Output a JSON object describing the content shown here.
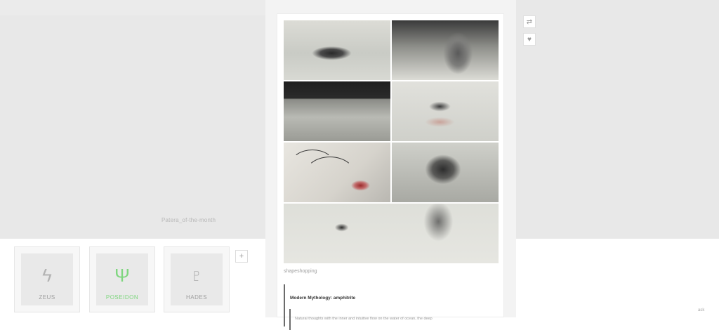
{
  "left_panel": {
    "caption": "Patera_of-the-month"
  },
  "post": {
    "source": "shapeshopping",
    "quote": {
      "title": "Modern Mythology: amphitrite",
      "text": "Natural thoughts with the inner and intuitive flow on the water of ocean, the deep"
    }
  },
  "actions": {
    "reblog_icon": "reblog-icon",
    "like_icon": "heart-icon"
  },
  "nav": {
    "cards": [
      {
        "icon": "lightning-icon",
        "glyph": "ϟ",
        "label": "ZEUS"
      },
      {
        "icon": "trident-icon",
        "glyph": "Ψ",
        "label": "POSEIDON",
        "active": true
      },
      {
        "icon": "pluto-symbol-icon",
        "glyph": "♇",
        "label": "HADES"
      }
    ],
    "more_label": "+"
  },
  "corner_tag": "ask",
  "colors": {
    "active_accent": "#7ed67e",
    "panel_gray": "#e8e8e8"
  }
}
